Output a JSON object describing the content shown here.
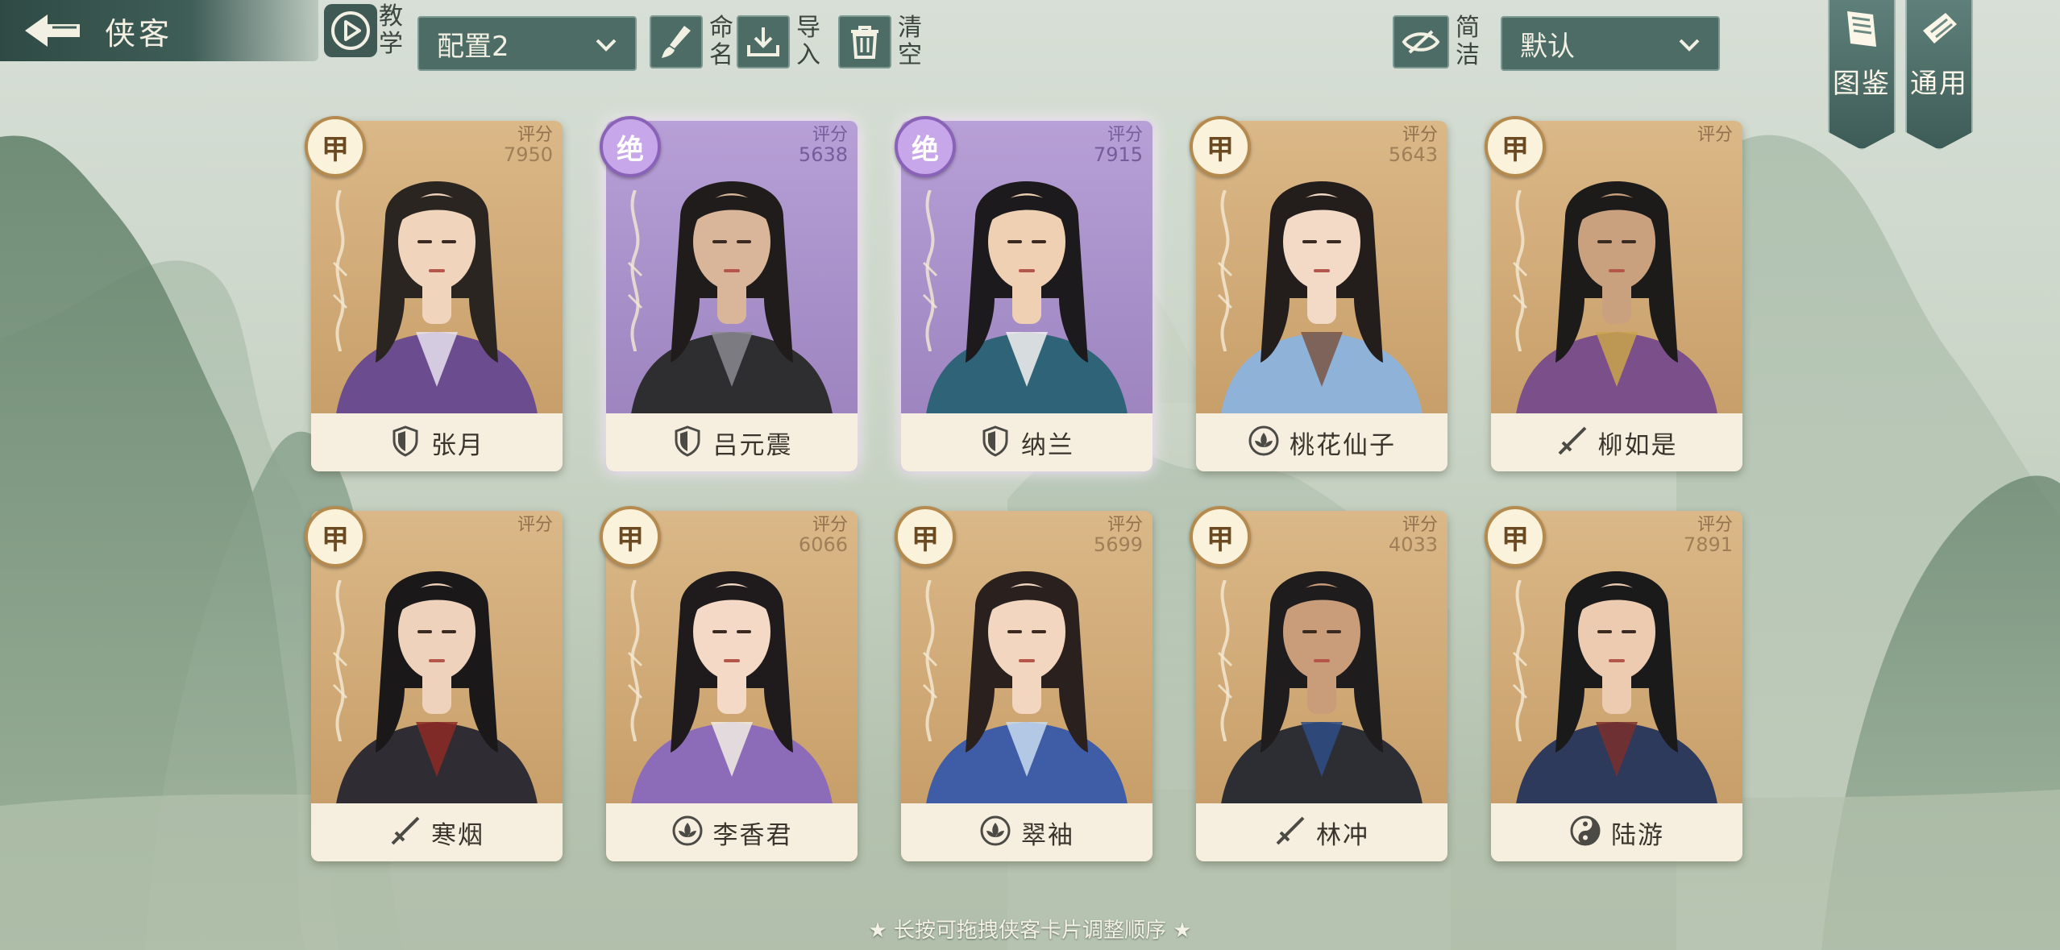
{
  "header": {
    "title": "侠客",
    "teach_label": "教学"
  },
  "toolbar": {
    "config_selected": "配置2",
    "rename_label": "命名",
    "import_label": "导入",
    "clear_label": "清空",
    "simple_label": "简洁",
    "sort_selected": "默认"
  },
  "side_buttons": {
    "codex": "图鉴",
    "general": "通用"
  },
  "cards": [
    {
      "name": "张月",
      "grade": "甲",
      "score_label": "评分",
      "score": "7950",
      "icon": "shield-icon",
      "rarity": "jia",
      "palette": {
        "hair": "#2b2522",
        "skin": "#f1d4bc",
        "robe": "#6b4c8e",
        "accent": "#e8e2ee"
      }
    },
    {
      "name": "吕元震",
      "grade": "绝",
      "score_label": "评分",
      "score": "5638",
      "icon": "shield-icon",
      "rarity": "jue",
      "palette": {
        "hair": "#1f1c1b",
        "skin": "#d9b699",
        "robe": "#2e2d30",
        "accent": "#8a8a8f"
      }
    },
    {
      "name": "纳兰",
      "grade": "绝",
      "score_label": "评分",
      "score": "7915",
      "icon": "shield-icon",
      "rarity": "jue",
      "palette": {
        "hair": "#1c1a1c",
        "skin": "#f0d0b3",
        "robe": "#2f6478",
        "accent": "#f4f2f0"
      }
    },
    {
      "name": "桃花仙子",
      "grade": "甲",
      "score_label": "评分",
      "score": "5643",
      "icon": "lotus-icon",
      "rarity": "jia",
      "palette": {
        "hair": "#231d1c",
        "skin": "#f3dac7",
        "robe": "#8fb2d8",
        "accent": "#7a5544"
      }
    },
    {
      "name": "柳如是",
      "grade": "甲",
      "score_label": "评分",
      "score": "",
      "icon": "sword-icon",
      "rarity": "jia",
      "palette": {
        "hair": "#1d1a1a",
        "skin": "#c9a17f",
        "robe": "#7a4f8a",
        "accent": "#c9a54a"
      }
    },
    {
      "name": "寒烟",
      "grade": "甲",
      "score_label": "评分",
      "score": "",
      "icon": "sword-icon",
      "rarity": "jia",
      "palette": {
        "hair": "#1b1819",
        "skin": "#efd2bb",
        "robe": "#2f2d33",
        "accent": "#8d2a24"
      }
    },
    {
      "name": "李香君",
      "grade": "甲",
      "score_label": "评分",
      "score": "6066",
      "icon": "lotus-icon",
      "rarity": "jia",
      "palette": {
        "hair": "#1f1a1b",
        "skin": "#f3d9c6",
        "robe": "#8c6cb8",
        "accent": "#f2ede4"
      }
    },
    {
      "name": "翠袖",
      "grade": "甲",
      "score_label": "评分",
      "score": "5699",
      "icon": "lotus-icon",
      "rarity": "jia",
      "palette": {
        "hair": "#2a201d",
        "skin": "#f2d6c0",
        "robe": "#3f5ca6",
        "accent": "#c8dbee"
      }
    },
    {
      "name": "林冲",
      "grade": "甲",
      "score_label": "评分",
      "score": "4033",
      "icon": "sword-icon",
      "rarity": "jia",
      "palette": {
        "hair": "#1e1c1c",
        "skin": "#c99c7a",
        "robe": "#2c2e33",
        "accent": "#2f4c86"
      }
    },
    {
      "name": "陆游",
      "grade": "甲",
      "score_label": "评分",
      "score": "7891",
      "icon": "yinyang-icon",
      "rarity": "jia",
      "palette": {
        "hair": "#1b1a1b",
        "skin": "#eccbb0",
        "robe": "#2d3a5c",
        "accent": "#7a2f2a"
      }
    }
  ],
  "footer": {
    "tip": "★ 长按可拖拽侠客卡片调整顺序 ★"
  }
}
